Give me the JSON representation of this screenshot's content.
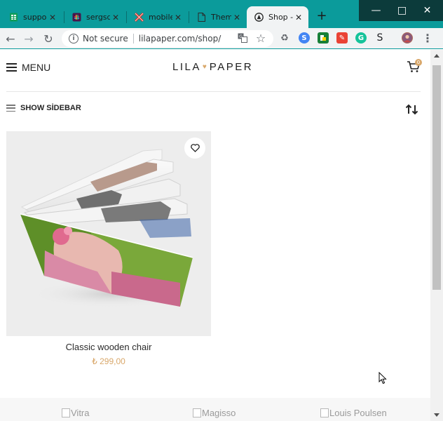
{
  "browser": {
    "tabs": [
      {
        "title": "suppor",
        "icon": "sheets-icon",
        "active": false
      },
      {
        "title": "sergsd",
        "icon": "slack-icon",
        "active": false
      },
      {
        "title": "mobile",
        "icon": "x-logo-icon",
        "active": false
      },
      {
        "title": "Theme",
        "icon": "document-icon",
        "active": false
      },
      {
        "title": "Shop -",
        "icon": "site-icon",
        "active": true
      }
    ],
    "new_tab": "+",
    "security_label": "Not secure",
    "url": "lilapaper.com/shop/"
  },
  "site": {
    "menu_label": "MENU",
    "logo_left": "LILA",
    "logo_right": "PAPER",
    "cart_count": "0",
    "show_sidebar_label": "SHOW SİDEBAR"
  },
  "products": [
    {
      "name": "Classic wooden chair",
      "price": "₺ 299,00"
    }
  ],
  "brands": [
    "Vitra",
    "Magisso",
    "Louis Poulsen"
  ],
  "colors": {
    "accent": "#d9a86b",
    "tabstrip": "#0b9b9b",
    "titlebar_controls": "#0c3b3b"
  }
}
